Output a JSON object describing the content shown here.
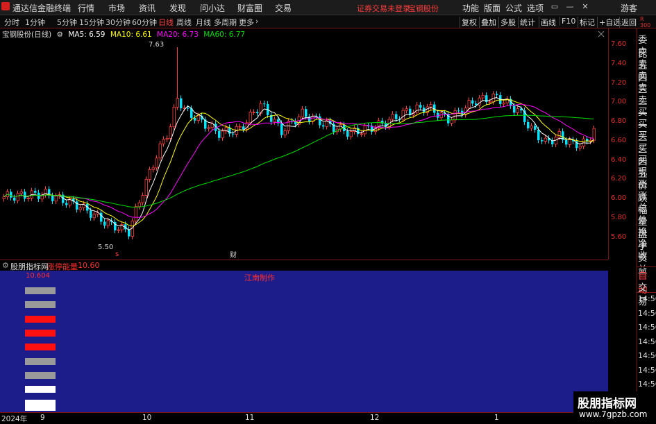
{
  "menubar": {
    "app_title": "通达信金融终端",
    "items": [
      "行情",
      "市场",
      "资讯",
      "发现",
      "问小达",
      "财富圈",
      "交易"
    ],
    "alert": "证券交易未登录",
    "stock_link": "宝钢股份",
    "right_items": [
      "功能",
      "版面",
      "公式",
      "选项"
    ],
    "guest": "游客"
  },
  "periodbar": {
    "periods": [
      "分时",
      "1分钟",
      "5分钟",
      "15分钟",
      "30分钟",
      "60分钟",
      "日线",
      "周线",
      "月线",
      "多周期",
      "更多"
    ],
    "active": "日线",
    "tools": [
      "复权",
      "叠加",
      "多股",
      "统计",
      "画线",
      "F10",
      "标记",
      "+自选",
      "返回"
    ]
  },
  "legend": {
    "stock": "宝钢股份(日线)",
    "ma5": "MA5: 6.59",
    "ma10": "MA10: 6.61",
    "ma20": "MA20: 6.73",
    "ma60": "MA60: 6.77",
    "high_label": "7.63",
    "low_label": "5.50",
    "s_marker": "s",
    "cai_marker": "财"
  },
  "colors": {
    "up": "#ff4040",
    "down": "#00e5ff",
    "ma5": "#ffffff",
    "ma10": "#ffff00",
    "ma20": "#ff00ff",
    "ma60": "#00e000"
  },
  "price_axis": {
    "ticks": [
      "7.60",
      "7.40",
      "7.20",
      "7.00",
      "6.80",
      "6.60",
      "6.40",
      "6.20",
      "6.00",
      "5.80",
      "5.60"
    ],
    "corner_r": "R",
    "corner_code": "300"
  },
  "side_panel": {
    "items": [
      "委比",
      "卖五",
      "卖四",
      "卖三",
      "卖二",
      "卖一",
      "买一",
      "买二",
      "买三",
      "买四",
      "买五",
      "现价",
      "涨跌",
      "涨幅",
      "总量",
      "外盘",
      "换手",
      "净资",
      "收益"
    ],
    "mode_auto": "自动",
    "mode_trade": "交易",
    "times": [
      "14:56",
      "14:56",
      "14:56",
      "14:56",
      "14:56",
      "14:56",
      "14:56",
      "14:56"
    ]
  },
  "indicator": {
    "name": "股朋指标网",
    "label": "涨停能量",
    "value": "10.60",
    "bar_value": "10.604",
    "author": "江南制作",
    "bars": [
      {
        "color": "#9a9a9a"
      },
      {
        "color": "#9a9a9a"
      },
      {
        "color": "#ff1010"
      },
      {
        "color": "#ff1010"
      },
      {
        "color": "#ff1010"
      },
      {
        "color": "#9a9a9a"
      },
      {
        "color": "#9a9a9a"
      },
      {
        "color": "#ffffff"
      },
      {
        "color": "#ffffff"
      }
    ]
  },
  "date_axis": {
    "labels": [
      "2024年",
      "9",
      "10",
      "11",
      "12",
      "1"
    ]
  },
  "watermark": {
    "line1": "股朋指标网",
    "line2": "www.7gpzb.com"
  }
}
